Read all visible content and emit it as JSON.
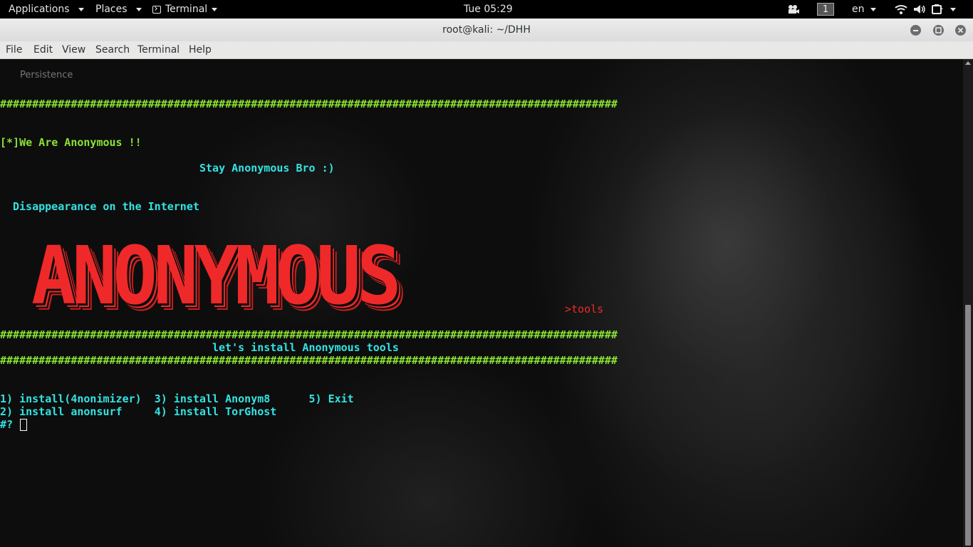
{
  "topbar": {
    "applications": "Applications",
    "places": "Places",
    "terminal": "Terminal",
    "clock": "Tue 05:29",
    "workspace": "1",
    "language": "en"
  },
  "window": {
    "title": "root@kali: ~/DHH"
  },
  "menu": {
    "file": "File",
    "edit": "Edit",
    "view": "View",
    "search": "Search",
    "terminal": "Terminal",
    "help": "Help"
  },
  "terminal": {
    "faded_text": "Persistence",
    "hash_line": "################################################################################################",
    "we_are": "[*]We Are Anonymous !!",
    "stay": "Stay Anonymous Bro :)",
    "disappearance": "Disappearance on the Internet",
    "banner": "ANONYMOUS",
    "tools_tag": ">tools",
    "install_title": "let's install Anonymous tools",
    "menu_row1": "1) install(4nonimizer)  3) install Anonym8      5) Exit",
    "menu_row2": "2) install anonsurf     4) install TorGhost",
    "prompt": "#?"
  },
  "colors": {
    "green": "#8ae234",
    "cyan": "#34e2e2",
    "red": "#ef2929"
  },
  "icons": [
    "terminal-icon",
    "caret-down-icon",
    "screenshot-icon",
    "wifi-icon",
    "volume-icon",
    "battery-icon",
    "minimize-icon",
    "maximize-icon",
    "close-icon"
  ]
}
